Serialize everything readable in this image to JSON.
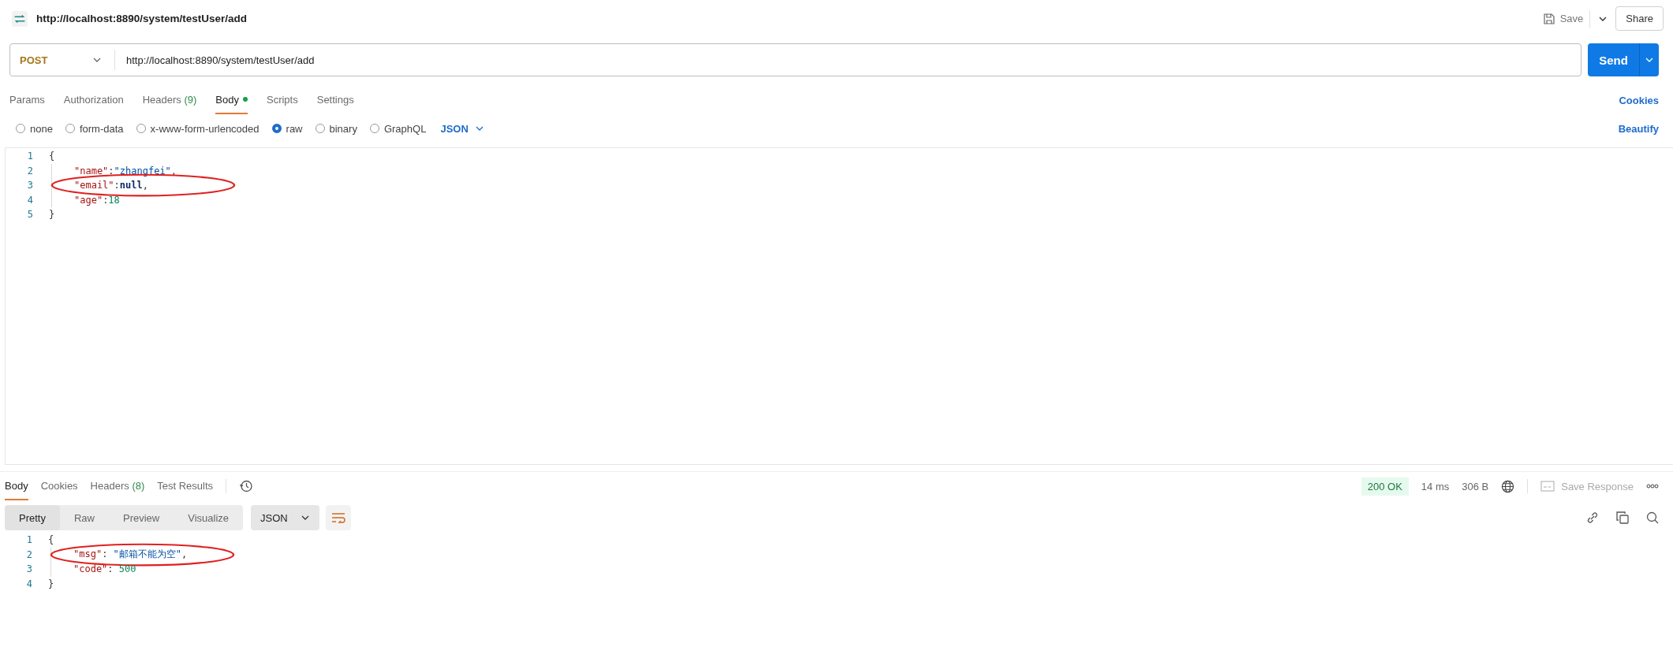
{
  "header": {
    "title": "http://localhost:8890/system/testUser/add",
    "save": "Save",
    "share": "Share"
  },
  "request": {
    "method": "POST",
    "url": "http://localhost:8890/system/testUser/add",
    "send": "Send"
  },
  "request_tabs": [
    {
      "label": "Params",
      "selected": false,
      "dot": false
    },
    {
      "label": "Authorization",
      "selected": false,
      "dot": false
    },
    {
      "label": "Headers",
      "count": "(9)",
      "selected": false,
      "dot": false
    },
    {
      "label": "Body",
      "selected": true,
      "dot": true
    },
    {
      "label": "Scripts",
      "selected": false,
      "dot": false
    },
    {
      "label": "Settings",
      "selected": false,
      "dot": false
    }
  ],
  "cookies_link": "Cookies",
  "body_types": [
    {
      "label": "none",
      "selected": false
    },
    {
      "label": "form-data",
      "selected": false
    },
    {
      "label": "x-www-form-urlencoded",
      "selected": false
    },
    {
      "label": "raw",
      "selected": true
    },
    {
      "label": "binary",
      "selected": false
    },
    {
      "label": "GraphQL",
      "selected": false
    }
  ],
  "language": "JSON",
  "beautify": "Beautify",
  "request_body": [
    {
      "number": "1",
      "indented": false,
      "highlighted": false,
      "tokens": [
        {
          "kind": "punct",
          "text": "{"
        }
      ]
    },
    {
      "number": "2",
      "indented": true,
      "highlighted": false,
      "tokens": [
        {
          "kind": "key",
          "text": "\"name\""
        },
        {
          "kind": "punct",
          "text": ":"
        },
        {
          "kind": "string",
          "text": "\"zhangfei\""
        },
        {
          "kind": "punct",
          "text": ","
        }
      ]
    },
    {
      "number": "3",
      "indented": true,
      "highlighted": true,
      "tokens": [
        {
          "kind": "key",
          "text": "\"email\""
        },
        {
          "kind": "punct",
          "text": ":"
        },
        {
          "kind": "null",
          "text": "null"
        },
        {
          "kind": "punct",
          "text": ","
        }
      ]
    },
    {
      "number": "4",
      "indented": true,
      "highlighted": false,
      "tokens": [
        {
          "kind": "key",
          "text": "\"age\""
        },
        {
          "kind": "punct",
          "text": ":"
        },
        {
          "kind": "number",
          "text": "18"
        }
      ]
    },
    {
      "number": "5",
      "indented": false,
      "highlighted": false,
      "tokens": [
        {
          "kind": "punct",
          "text": "}"
        }
      ]
    }
  ],
  "response_tabs": [
    {
      "label": "Body",
      "selected": true
    },
    {
      "label": "Cookies",
      "selected": false
    },
    {
      "label": "Headers",
      "count": "(8)",
      "selected": false
    },
    {
      "label": "Test Results",
      "selected": false
    }
  ],
  "response_status": {
    "status": "200 OK",
    "time": "14 ms",
    "size": "306 B",
    "save_response": "Save Response"
  },
  "view_modes": [
    {
      "label": "Pretty",
      "selected": true
    },
    {
      "label": "Raw",
      "selected": false
    },
    {
      "label": "Preview",
      "selected": false
    },
    {
      "label": "Visualize",
      "selected": false
    }
  ],
  "response_language": "JSON",
  "response_body": [
    {
      "number": "1",
      "indented": false,
      "highlighted": false,
      "tokens": [
        {
          "kind": "punct",
          "text": "{"
        }
      ]
    },
    {
      "number": "2",
      "indented": true,
      "highlighted": true,
      "tokens": [
        {
          "kind": "key",
          "text": "\"msg\""
        },
        {
          "kind": "punct",
          "text": ": "
        },
        {
          "kind": "string",
          "text": "\"邮箱不能为空\""
        },
        {
          "kind": "punct",
          "text": ","
        }
      ]
    },
    {
      "number": "3",
      "indented": true,
      "highlighted": false,
      "tokens": [
        {
          "kind": "key",
          "text": "\"code\""
        },
        {
          "kind": "punct",
          "text": ": "
        },
        {
          "kind": "number",
          "text": "500"
        }
      ]
    },
    {
      "number": "4",
      "indented": false,
      "highlighted": false,
      "tokens": [
        {
          "kind": "punct",
          "text": "}"
        }
      ]
    }
  ]
}
